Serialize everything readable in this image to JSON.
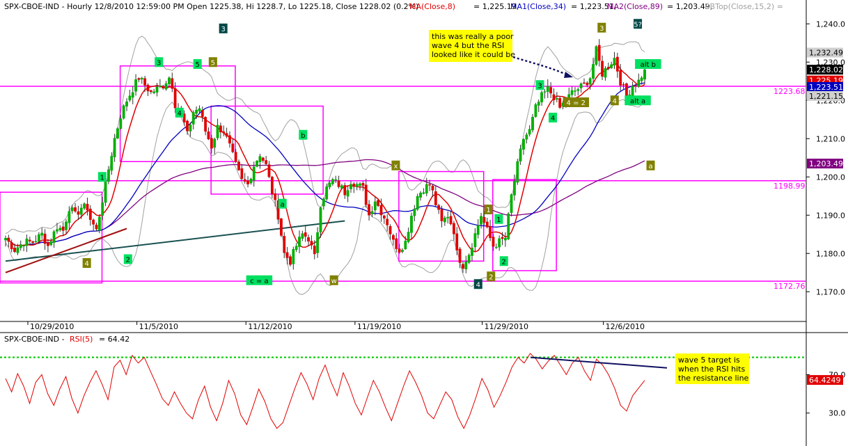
{
  "header": {
    "symbol": "SPX-CBOE-IND - Hourly 12/8/2010 12:59:00 PM Open 1225.38, Hi 1228.7, Lo 1225.18, Close 1228.02 (0.2%)",
    "ma8": "MA(Close,8)",
    "ma8_val": "= 1,225.19,",
    "ma34": "MA1(Close,34)",
    "ma34_val": "= 1,223.51,",
    "ma89": "MA2(Close,89)",
    "ma89_val": "= 1,203.49,",
    "bb": "BBTop(Close,15,2) ="
  },
  "rsi_header": {
    "prefix": "SPX-CBOE-IND -",
    "label": "RSI(5)",
    "value": "= 64.42"
  },
  "colors": {
    "price_up": "#00b000",
    "price_down": "#e00000",
    "ma8": "#e00000",
    "ma34": "#0000c0",
    "ma89": "#800080",
    "bb": "#a0a0a0",
    "magenta": "#ff00ff",
    "green_label": "#00e060",
    "olive_label": "#808000",
    "teal_label": "#004848",
    "note_bg": "#ffff00",
    "rsi": "#e00000",
    "rsi_resistance": "#00cc00"
  },
  "price_axis": {
    "ticks": [
      "1,240.0",
      "1,230.0",
      "1,220.0",
      "1,210.0",
      "1,200.0",
      "1,190.0",
      "1,180.0",
      "1,170.0"
    ],
    "tick_values": [
      1240,
      1230,
      1220,
      1210,
      1200,
      1190,
      1180,
      1170
    ],
    "ylim": [
      1163.5,
      1243.5
    ],
    "tags": [
      {
        "text": "1,232.49",
        "value": 1232.49,
        "bg": "#d0d0d0",
        "fg": "#000000"
      },
      {
        "text": "1,228.02",
        "value": 1228.02,
        "bg": "#000000",
        "fg": "#ffffff"
      },
      {
        "text": "1,225.19",
        "value": 1225.19,
        "bg": "#e00000",
        "fg": "#ffffff"
      },
      {
        "text": "1,223.51",
        "value": 1223.51,
        "bg": "#0000c0",
        "fg": "#ffffff"
      },
      {
        "text": "1,221.15",
        "value": 1221.15,
        "bg": "#d0d0d0",
        "fg": "#000000"
      },
      {
        "text": "1,203.49",
        "value": 1203.49,
        "bg": "#800080",
        "fg": "#ffffff"
      }
    ]
  },
  "rsi_axis": {
    "ticks": [
      "70.0",
      "30.0"
    ],
    "tick_values": [
      70,
      30
    ],
    "ylim": [
      0,
      100
    ],
    "tag": {
      "text": "64.4249",
      "value": 64.42
    }
  },
  "dates": [
    "10/29/2010",
    "11/5/2010",
    "11/12/2010",
    "11/19/2010",
    "11/29/2010",
    "12/6/2010"
  ],
  "hlines": [
    {
      "value": 1223.68,
      "label": "1223.68"
    },
    {
      "value": 1198.99,
      "label": "1198.99"
    },
    {
      "value": 1172.76,
      "label": "1172.76"
    }
  ],
  "wave_labels": [
    {
      "text": "1",
      "kind": "green"
    },
    {
      "text": "2",
      "kind": "green"
    },
    {
      "text": "4",
      "kind": "olive"
    },
    {
      "text": "3",
      "kind": "green"
    },
    {
      "text": "5",
      "kind": "green"
    },
    {
      "text": "5",
      "kind": "olive"
    },
    {
      "text": "3",
      "kind": "teal"
    },
    {
      "text": "4",
      "kind": "green"
    },
    {
      "text": "b",
      "kind": "green"
    },
    {
      "text": "a",
      "kind": "green"
    },
    {
      "text": "c = a",
      "kind": "green"
    },
    {
      "text": "w",
      "kind": "olive"
    },
    {
      "text": "x",
      "kind": "olive"
    },
    {
      "text": "1",
      "kind": "olive"
    },
    {
      "text": "2",
      "kind": "olive"
    },
    {
      "text": "4",
      "kind": "teal"
    },
    {
      "text": "1",
      "kind": "green"
    },
    {
      "text": "2",
      "kind": "green"
    },
    {
      "text": "3",
      "kind": "green"
    },
    {
      "text": "4",
      "kind": "green"
    },
    {
      "text": "4 = 2",
      "kind": "olive"
    },
    {
      "text": "3",
      "kind": "olive"
    },
    {
      "text": "5?",
      "kind": "teal"
    },
    {
      "text": "alt b",
      "kind": "green"
    },
    {
      "text": "4",
      "kind": "olive"
    },
    {
      "text": "alt a",
      "kind": "green"
    },
    {
      "text": "a",
      "kind": "olive"
    }
  ],
  "notes": {
    "wave4_note": [
      "this was really a poor",
      "wave 4 but the RSI",
      "looked like it could be"
    ],
    "rsi_note": [
      "wave 5 target is",
      "when the RSI hits",
      "the resistance line"
    ]
  },
  "chart_data": [
    {
      "type": "candlestick",
      "title": "SPX-CBOE-IND - Hourly 12/8/2010 12:59:00 PM Open 1225.38, Hi 1228.7, Lo 1225.18, Close 1228.02 (0.2%)",
      "x_dates": [
        "10/29/2010",
        "11/5/2010",
        "11/12/2010",
        "11/19/2010",
        "11/29/2010",
        "12/6/2010"
      ],
      "ylim": [
        1163.5,
        1243.5
      ],
      "price_path": [
        [
          0,
          1184
        ],
        [
          3,
          1181
        ],
        [
          6,
          1183
        ],
        [
          9,
          1183
        ],
        [
          12,
          1185
        ],
        [
          14,
          1182
        ],
        [
          17,
          1187
        ],
        [
          19,
          1186
        ],
        [
          21,
          1192
        ],
        [
          23,
          1190
        ],
        [
          25,
          1192
        ],
        [
          27,
          1192
        ],
        [
          28,
          1189
        ],
        [
          30,
          1186
        ],
        [
          32,
          1194
        ],
        [
          34,
          1202
        ],
        [
          36,
          1210
        ],
        [
          38,
          1216
        ],
        [
          40,
          1220
        ],
        [
          42,
          1223
        ],
        [
          44,
          1226
        ],
        [
          46,
          1224
        ],
        [
          48,
          1222
        ],
        [
          50,
          1223
        ],
        [
          52,
          1224
        ],
        [
          54,
          1226
        ],
        [
          55,
          1224
        ],
        [
          56,
          1219
        ],
        [
          58,
          1216
        ],
        [
          59,
          1214
        ],
        [
          60,
          1211
        ],
        [
          62,
          1217
        ],
        [
          64,
          1218
        ],
        [
          66,
          1212
        ],
        [
          68,
          1208
        ],
        [
          70,
          1213
        ],
        [
          72,
          1212
        ],
        [
          74,
          1208
        ],
        [
          76,
          1203
        ],
        [
          78,
          1199
        ],
        [
          80,
          1198
        ],
        [
          82,
          1203
        ],
        [
          84,
          1206
        ],
        [
          86,
          1203
        ],
        [
          88,
          1196
        ],
        [
          90,
          1190
        ],
        [
          92,
          1180
        ],
        [
          94,
          1178
        ],
        [
          96,
          1182
        ],
        [
          98,
          1185
        ],
        [
          100,
          1184
        ],
        [
          102,
          1179
        ],
        [
          104,
          1193
        ],
        [
          106,
          1197
        ],
        [
          108,
          1199
        ],
        [
          110,
          1198
        ],
        [
          112,
          1196
        ],
        [
          114,
          1199
        ],
        [
          116,
          1198
        ],
        [
          118,
          1197
        ],
        [
          120,
          1190
        ],
        [
          122,
          1194
        ],
        [
          124,
          1191
        ],
        [
          126,
          1188
        ],
        [
          128,
          1183
        ],
        [
          130,
          1181
        ],
        [
          132,
          1183
        ],
        [
          134,
          1190
        ],
        [
          136,
          1195
        ],
        [
          138,
          1197
        ],
        [
          140,
          1198
        ],
        [
          141,
          1196
        ],
        [
          142,
          1193
        ],
        [
          144,
          1188
        ],
        [
          146,
          1190
        ],
        [
          148,
          1186
        ],
        [
          149,
          1180
        ],
        [
          151,
          1177
        ],
        [
          153,
          1180
        ],
        [
          155,
          1185
        ],
        [
          157,
          1190
        ],
        [
          159,
          1186
        ],
        [
          161,
          1182
        ],
        [
          163,
          1183
        ],
        [
          165,
          1184
        ],
        [
          167,
          1195
        ],
        [
          169,
          1203
        ],
        [
          171,
          1210
        ],
        [
          173,
          1212
        ],
        [
          175,
          1218
        ],
        [
          177,
          1221
        ],
        [
          179,
          1223
        ],
        [
          181,
          1221
        ],
        [
          183,
          1218
        ],
        [
          185,
          1220
        ],
        [
          187,
          1222
        ],
        [
          189,
          1223
        ],
        [
          191,
          1224
        ],
        [
          193,
          1226
        ],
        [
          195,
          1233
        ],
        [
          197,
          1227
        ],
        [
          199,
          1229
        ],
        [
          201,
          1231
        ],
        [
          203,
          1225
        ],
        [
          205,
          1221
        ],
        [
          207,
          1224
        ],
        [
          209,
          1225
        ],
        [
          211,
          1228
        ]
      ],
      "moving_averages": [
        {
          "name": "MA(Close,8)",
          "last": 1225.19
        },
        {
          "name": "MA1(Close,34)",
          "last": 1223.51
        },
        {
          "name": "MA2(Close,89)",
          "last": 1203.49
        }
      ],
      "bollinger_top_last": 1232.49,
      "horizontal_levels": [
        1223.68,
        1198.99,
        1172.76
      ],
      "last_close": 1228.02
    },
    {
      "type": "line",
      "title": "SPX-CBOE-IND - RSI(5) = 64.42",
      "ylim": [
        0,
        100
      ],
      "yticks": [
        70,
        30
      ],
      "last_value": 64.42,
      "series": [
        {
          "name": "RSI(5)",
          "values": [
            66,
            52,
            71,
            58,
            40,
            62,
            70,
            50,
            38,
            55,
            68,
            45,
            30,
            48,
            62,
            74,
            60,
            44,
            78,
            85,
            70,
            90,
            82,
            88,
            74,
            60,
            45,
            38,
            52,
            40,
            30,
            24,
            44,
            58,
            36,
            22,
            40,
            64,
            50,
            28,
            18,
            36,
            55,
            42,
            24,
            14,
            20,
            38,
            56,
            72,
            60,
            44,
            66,
            80,
            62,
            48,
            72,
            58,
            40,
            28,
            46,
            64,
            52,
            36,
            22,
            40,
            58,
            74,
            62,
            48,
            30,
            24,
            38,
            52,
            44,
            26,
            14,
            28,
            46,
            66,
            54,
            36,
            48,
            62,
            78,
            88,
            82,
            92,
            86,
            76,
            84,
            90,
            80,
            70,
            82,
            88,
            74,
            64,
            86,
            80,
            70,
            56,
            38,
            32,
            48,
            56,
            64
          ]
        }
      ],
      "resistance_line": [
        88,
        77
      ],
      "overbought_level": 88
    }
  ]
}
